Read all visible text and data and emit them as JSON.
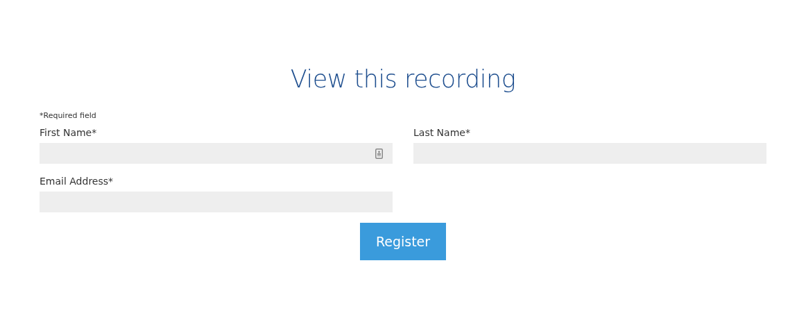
{
  "title": "View this recording",
  "required_note": "*Required field",
  "fields": [
    {
      "label": "First Name*",
      "autofill_icon": true
    },
    {
      "label": "Last Name*",
      "autofill_icon": false
    },
    {
      "label": "Email Address*",
      "autofill_icon": false
    }
  ],
  "submit_button": "Register"
}
